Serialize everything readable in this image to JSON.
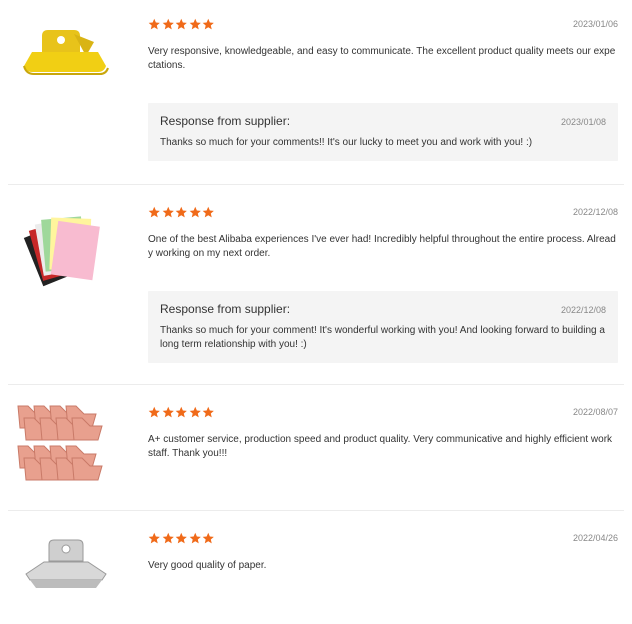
{
  "colors": {
    "star": "#f06a19",
    "response_bg": "#f4f4f4",
    "date": "#888888",
    "divider": "#ececec"
  },
  "reviews": [
    {
      "rating": 5,
      "date": "2023/01/06",
      "text": "Very responsive, knowledgeable, and easy to communicate. The excellent product quality meets our expectations.",
      "product_image": "yellow-clip-icon",
      "response": {
        "title": "Response from supplier:",
        "date": "2023/01/08",
        "text": "Thanks so much for your comments!! It's our lucky to meet you and work with you! :)"
      }
    },
    {
      "rating": 5,
      "date": "2022/12/08",
      "text": "One of the best Alibaba experiences I've ever had! Incredibly helpful throughout the entire process. Already working on my next order.",
      "product_image": "colored-paper-icon",
      "response": {
        "title": "Response from supplier:",
        "date": "2022/12/08",
        "text": "Thanks so much for your comment! It's wonderful working with you! And looking forward to building a long term relationship with you! :)"
      }
    },
    {
      "rating": 5,
      "date": "2022/08/07",
      "text": "A+ customer service, production speed and product quality. Very communicative and highly efficient work staff. Thank you!!!",
      "product_image": "rose-gold-clips-icon"
    },
    {
      "rating": 5,
      "date": "2022/04/26",
      "text": "Very good quality of paper.",
      "product_image": "silver-clip-icon"
    }
  ]
}
